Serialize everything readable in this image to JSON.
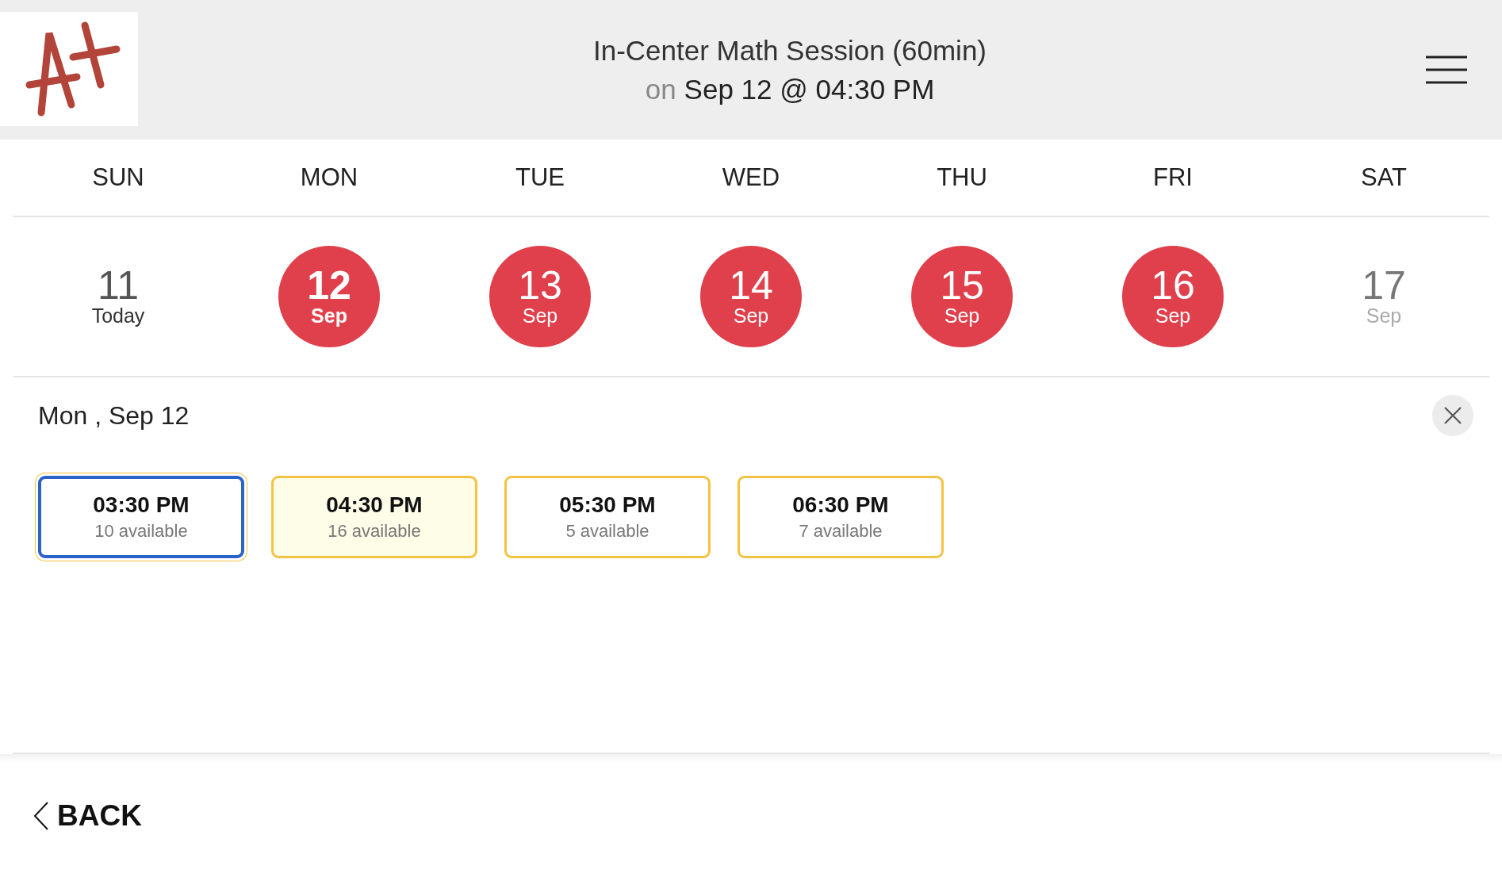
{
  "header": {
    "title": "In-Center Math Session (60min)",
    "subtitle_prefix": "on",
    "subtitle": "Sep 12 @ 04:30 PM"
  },
  "weekdays": [
    "SUN",
    "MON",
    "TUE",
    "WED",
    "THU",
    "FRI",
    "SAT"
  ],
  "dates": [
    {
      "day": "11",
      "sub": "Today",
      "kind": "today",
      "selected": false
    },
    {
      "day": "12",
      "sub": "Sep",
      "kind": "available",
      "selected": true
    },
    {
      "day": "13",
      "sub": "Sep",
      "kind": "available",
      "selected": false
    },
    {
      "day": "14",
      "sub": "Sep",
      "kind": "available",
      "selected": false
    },
    {
      "day": "15",
      "sub": "Sep",
      "kind": "available",
      "selected": false
    },
    {
      "day": "16",
      "sub": "Sep",
      "kind": "available",
      "selected": false
    },
    {
      "day": "17",
      "sub": "Sep",
      "kind": "unavailable",
      "selected": false
    }
  ],
  "selected_date": "Mon , Sep 12",
  "slots": [
    {
      "time": "03:30 PM",
      "availability": "10 available",
      "selected": true,
      "current": false
    },
    {
      "time": "04:30 PM",
      "availability": "16 available",
      "selected": false,
      "current": true
    },
    {
      "time": "05:30 PM",
      "availability": "5 available",
      "selected": false,
      "current": false
    },
    {
      "time": "06:30 PM",
      "availability": "7 available",
      "selected": false,
      "current": false
    }
  ],
  "back": "BACK"
}
